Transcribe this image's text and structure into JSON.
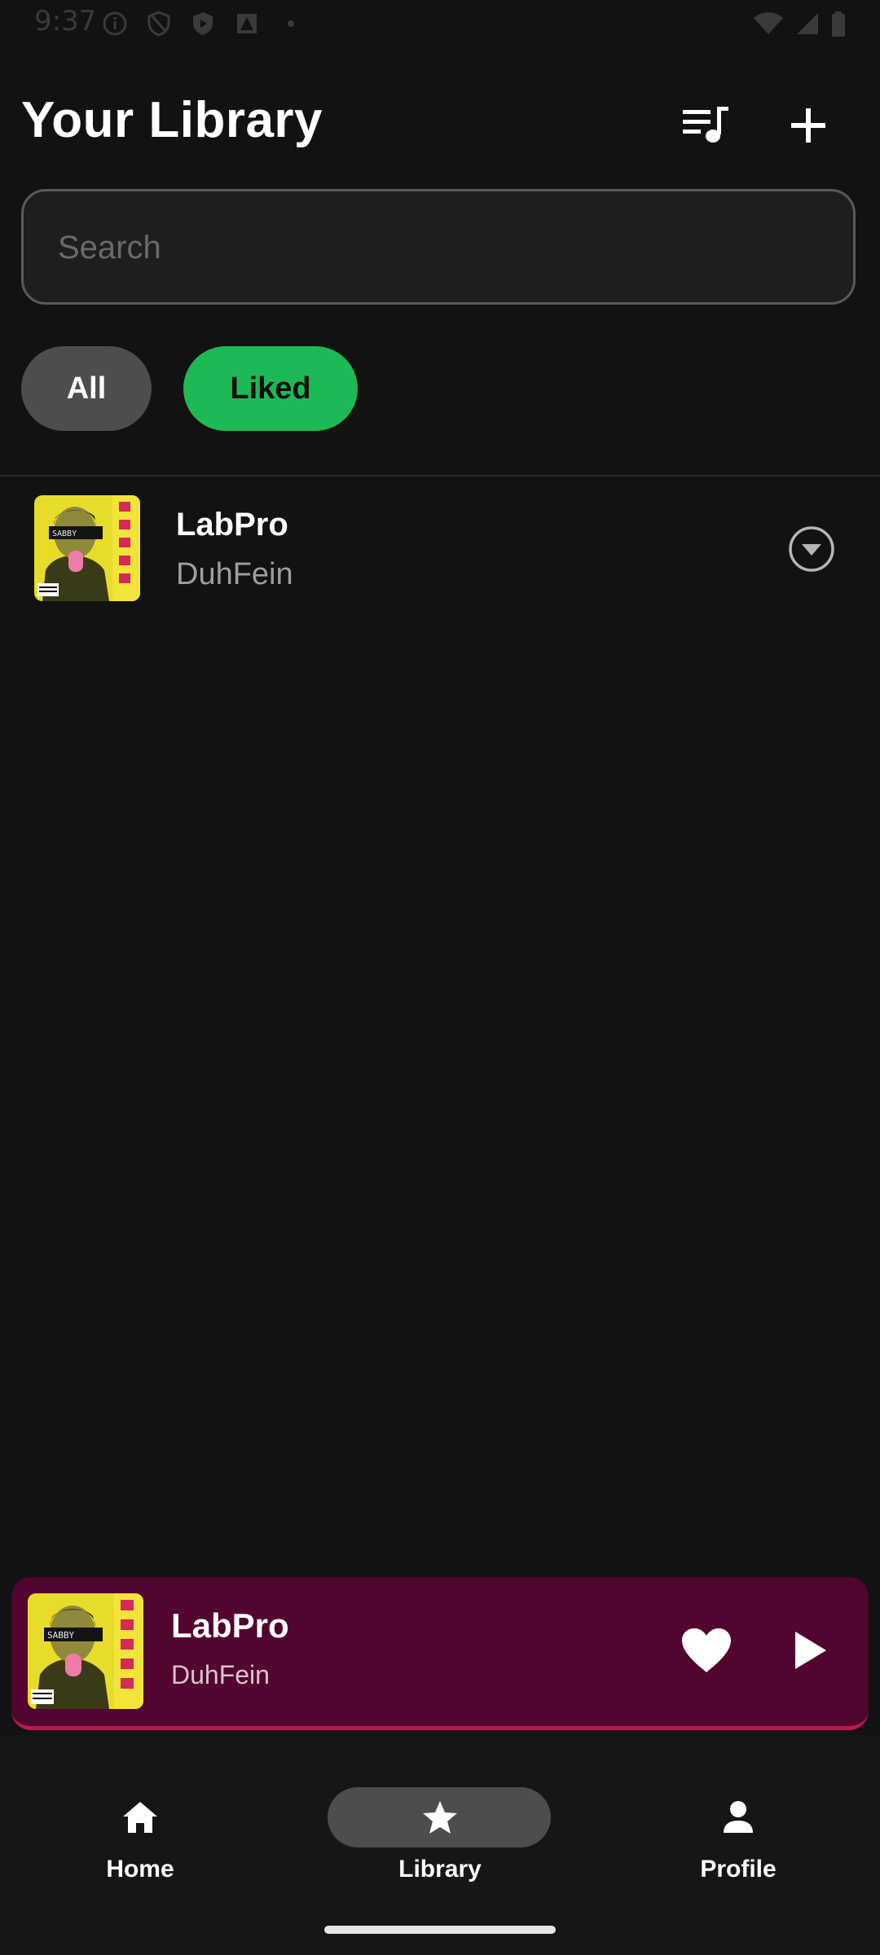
{
  "status_bar": {
    "time": "9:37",
    "left_icons": [
      "info-icon",
      "shield-icon",
      "play-protect-icon",
      "alert-icon",
      "dot-icon"
    ],
    "right_icons": [
      "wifi-icon",
      "signal-icon",
      "battery-icon"
    ]
  },
  "header": {
    "title": "Your Library",
    "queue_icon": "queue-music-icon",
    "add_icon": "plus-icon"
  },
  "search": {
    "placeholder": "Search",
    "value": ""
  },
  "filters": {
    "chips": [
      {
        "label": "All",
        "selected": false
      },
      {
        "label": "Liked",
        "selected": true
      }
    ]
  },
  "library_items": [
    {
      "title": "LabPro",
      "artist": "DuhFein",
      "menu_icon": "chevron-down-circle-icon"
    }
  ],
  "mini_player": {
    "title": "LabPro",
    "artist": "DuhFein",
    "liked": true,
    "background_color": "#52052e",
    "accent_color": "#c0164e"
  },
  "bottom_nav": {
    "items": [
      {
        "label": "Home",
        "icon": "home-icon",
        "active": false
      },
      {
        "label": "Library",
        "icon": "star-icon",
        "active": true
      },
      {
        "label": "Profile",
        "icon": "person-icon",
        "active": false
      }
    ]
  },
  "colors": {
    "background": "#121212",
    "accent_green": "#1db954",
    "chip_gray": "#4d4d4d"
  }
}
